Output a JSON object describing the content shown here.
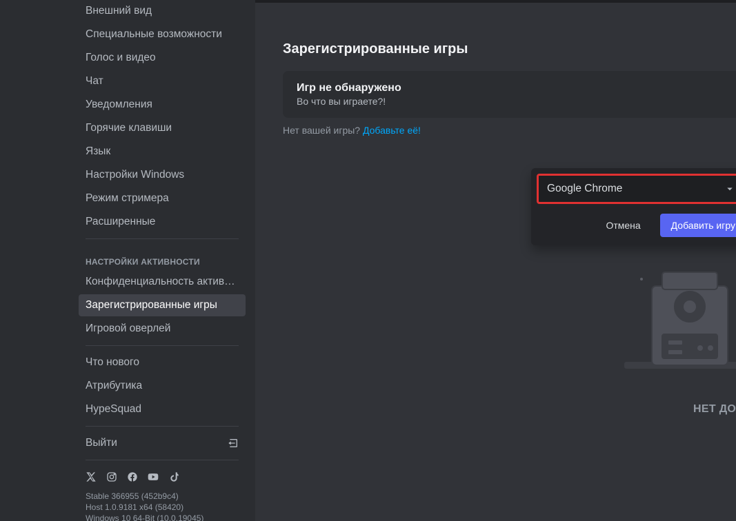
{
  "sidebar": {
    "items_top": [
      "Внешний вид",
      "Специальные возможности",
      "Голос и видео",
      "Чат",
      "Уведомления",
      "Горячие клавиши",
      "Язык",
      "Настройки Windows",
      "Режим стримера",
      "Расширенные"
    ],
    "activity_heading": "НАСТРОЙКИ АКТИВНОСТИ",
    "items_activity": [
      "Конфиденциальность актив…",
      "Зарегистрированные игры",
      "Игровой оверлей"
    ],
    "items_bottom": [
      "Что нового",
      "Атрибутика",
      "HypeSquad"
    ],
    "logout": "Выйти",
    "version": {
      "line1": "Stable 366955 (452b9c4)",
      "line2": "Host 1.0.9181 x64 (58420)",
      "line3": "Windows 10 64-Bit (10.0.19045)"
    }
  },
  "main": {
    "title": "Зарегистрированные игры",
    "card_title": "Игр не обнаружено",
    "card_sub": "Во что вы играете?!",
    "hint_prefix": "Нет вашей игры? ",
    "hint_link": "Добавьте её!",
    "empty_text": "НЕТ ДОБАВЛЕННЫХ ИГР",
    "select_value": "Google Chrome",
    "cancel": "Отмена",
    "add": "Добавить игру"
  }
}
